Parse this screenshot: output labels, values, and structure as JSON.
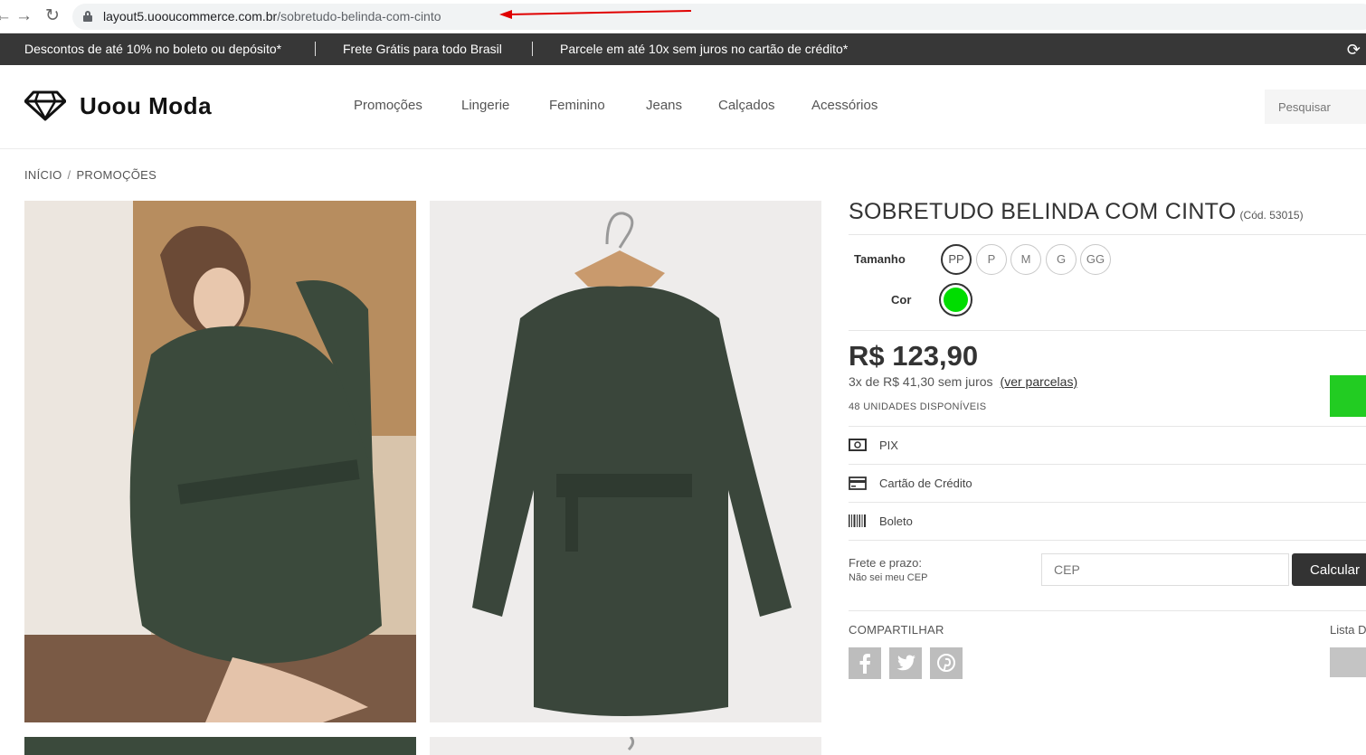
{
  "browser": {
    "url_host": "layout5.uooucommerce.com.br",
    "url_path": "/sobretudo-belinda-com-cinto"
  },
  "announcements": [
    "Descontos de até 10% no boleto ou depósito*",
    "Frete Grátis para todo Brasil",
    "Parcele em até 10x sem juros no cartão de crédito*"
  ],
  "header": {
    "logo": "Uoou Moda",
    "menu": [
      "Promoções",
      "Lingerie",
      "Feminino",
      "Jeans",
      "Calçados",
      "Acessórios"
    ],
    "search_placeholder": "Pesquisar"
  },
  "breadcrumb": [
    "INÍCIO",
    "PROMOÇÕES"
  ],
  "product": {
    "title": "SOBRETUDO BELINDA COM CINTO",
    "code": "(Cód. 53015)",
    "size_label": "Tamanho",
    "sizes": [
      "PP",
      "P",
      "M",
      "G",
      "GG"
    ],
    "selected_size": "PP",
    "color_label": "Cor",
    "color": "#00dd00",
    "price": "R$ 123,90",
    "installments": "3x de R$ 41,30 sem juros",
    "installments_link": "(ver parcelas)",
    "stock": "48 UNIDADES DISPONÍVEIS"
  },
  "payment": [
    "PIX",
    "Cartão de Crédito",
    "Boleto"
  ],
  "shipping": {
    "label": "Frete e prazo:",
    "link": "Não sei meu CEP",
    "placeholder": "CEP",
    "button": "Calcular"
  },
  "share": {
    "label": "COMPARTILHAR",
    "wishlist_label": "Lista D"
  },
  "colors": {
    "topbar": "#373737",
    "buy_button": "#22cc22",
    "arrow": "#e00000"
  }
}
